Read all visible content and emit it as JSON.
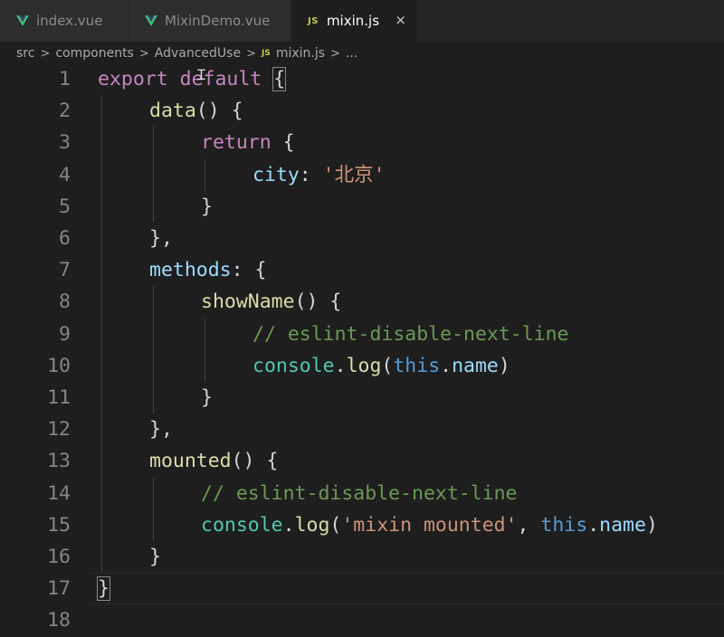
{
  "tabs": [
    {
      "label": "index.vue",
      "icon": "vue-icon",
      "active": false
    },
    {
      "label": "MixinDemo.vue",
      "icon": "vue-icon",
      "active": false
    },
    {
      "label": "mixin.js",
      "icon": "js-icon",
      "icon_text": "JS",
      "active": true
    }
  ],
  "close_glyph": "×",
  "breadcrumb": {
    "items": [
      "src",
      "components",
      "AdvancedUse",
      "mixin.js",
      "..."
    ],
    "separator": ">",
    "file_icon_text": "JS"
  },
  "colors": {
    "keyword": "#c586c0",
    "function": "#dcdcaa",
    "property": "#9cdcfe",
    "string": "#ce9178",
    "comment": "#6a9955",
    "class": "#4ec9b0",
    "this": "#569cd6",
    "punctuation": "#d4d4d4",
    "vue_green": "#41b883",
    "js_yellow": "#cbcb41"
  },
  "editor": {
    "lines": [
      {
        "n": "1",
        "indent": 0,
        "tokens": [
          [
            "kw",
            "export"
          ],
          [
            "p",
            " "
          ],
          [
            "kw",
            "default"
          ],
          [
            "p",
            " "
          ],
          [
            "pb",
            "{"
          ]
        ]
      },
      {
        "n": "2",
        "indent": 1,
        "tokens": [
          [
            "fn",
            "data"
          ],
          [
            "p",
            "() {"
          ]
        ]
      },
      {
        "n": "3",
        "indent": 2,
        "tokens": [
          [
            "kw",
            "return"
          ],
          [
            "p",
            " {"
          ]
        ]
      },
      {
        "n": "4",
        "indent": 3,
        "tokens": [
          [
            "prop",
            "city"
          ],
          [
            "p",
            ": "
          ],
          [
            "str",
            "'北京'"
          ]
        ]
      },
      {
        "n": "5",
        "indent": 2,
        "tokens": [
          [
            "p",
            "}"
          ]
        ]
      },
      {
        "n": "6",
        "indent": 1,
        "tokens": [
          [
            "p",
            "},"
          ]
        ]
      },
      {
        "n": "7",
        "indent": 1,
        "tokens": [
          [
            "prop",
            "methods"
          ],
          [
            "p",
            ": {"
          ]
        ]
      },
      {
        "n": "8",
        "indent": 2,
        "tokens": [
          [
            "fn",
            "showName"
          ],
          [
            "p",
            "() {"
          ]
        ]
      },
      {
        "n": "9",
        "indent": 3,
        "tokens": [
          [
            "cm",
            "// eslint-disable-next-line"
          ]
        ]
      },
      {
        "n": "10",
        "indent": 3,
        "tokens": [
          [
            "cls",
            "console"
          ],
          [
            "p",
            "."
          ],
          [
            "fn",
            "log"
          ],
          [
            "p",
            "("
          ],
          [
            "this",
            "this"
          ],
          [
            "p",
            "."
          ],
          [
            "prop",
            "name"
          ],
          [
            "p",
            ")"
          ]
        ]
      },
      {
        "n": "11",
        "indent": 2,
        "tokens": [
          [
            "p",
            "}"
          ]
        ]
      },
      {
        "n": "12",
        "indent": 1,
        "tokens": [
          [
            "p",
            "},"
          ]
        ]
      },
      {
        "n": "13",
        "indent": 1,
        "tokens": [
          [
            "fn",
            "mounted"
          ],
          [
            "p",
            "() {"
          ]
        ]
      },
      {
        "n": "14",
        "indent": 2,
        "tokens": [
          [
            "cm",
            "// eslint-disable-next-line"
          ]
        ]
      },
      {
        "n": "15",
        "indent": 2,
        "tokens": [
          [
            "cls",
            "console"
          ],
          [
            "p",
            "."
          ],
          [
            "fn",
            "log"
          ],
          [
            "p",
            "("
          ],
          [
            "str",
            "'mixin mounted'"
          ],
          [
            "p",
            ", "
          ],
          [
            "this",
            "this"
          ],
          [
            "p",
            "."
          ],
          [
            "prop",
            "name"
          ],
          [
            "p",
            ")"
          ]
        ]
      },
      {
        "n": "16",
        "indent": 1,
        "tokens": [
          [
            "p",
            "}"
          ]
        ]
      },
      {
        "n": "17",
        "indent": 0,
        "tokens": [
          [
            "pb",
            "}"
          ]
        ]
      },
      {
        "n": "18",
        "indent": 0,
        "tokens": []
      }
    ],
    "current_line": "17"
  }
}
